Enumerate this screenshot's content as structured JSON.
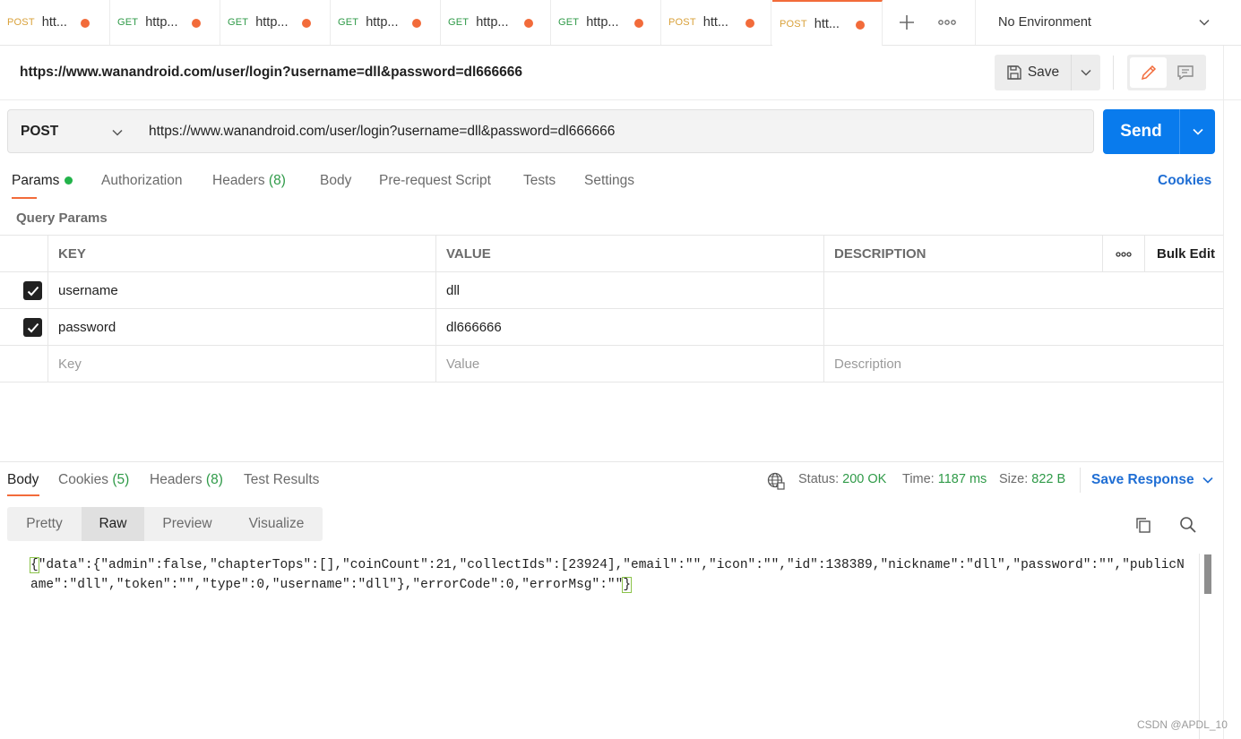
{
  "tabs": [
    {
      "method": "POST",
      "name": "htt..."
    },
    {
      "method": "GET",
      "name": "http..."
    },
    {
      "method": "GET",
      "name": "http..."
    },
    {
      "method": "GET",
      "name": "http..."
    },
    {
      "method": "GET",
      "name": "http..."
    },
    {
      "method": "GET",
      "name": "http..."
    },
    {
      "method": "POST",
      "name": "htt..."
    },
    {
      "method": "POST",
      "name": "htt..."
    }
  ],
  "environment": "No Environment",
  "request": {
    "title": "https://www.wanandroid.com/user/login?username=dll&password=dl666666",
    "save_label": "Save",
    "method": "POST",
    "url": "https://www.wanandroid.com/user/login?username=dll&password=dl666666",
    "send_label": "Send"
  },
  "request_tabs": {
    "params": "Params",
    "authorization": "Authorization",
    "headers": "Headers",
    "headers_count": "(8)",
    "body": "Body",
    "prerequest": "Pre-request Script",
    "tests": "Tests",
    "settings": "Settings",
    "cookies": "Cookies"
  },
  "query_params": {
    "title": "Query Params",
    "headers": {
      "key": "KEY",
      "value": "VALUE",
      "description": "DESCRIPTION",
      "bulk_edit": "Bulk Edit"
    },
    "rows": [
      {
        "key": "username",
        "value": "dll",
        "description": ""
      },
      {
        "key": "password",
        "value": "dl666666",
        "description": ""
      }
    ],
    "placeholders": {
      "key": "Key",
      "value": "Value",
      "description": "Description"
    }
  },
  "response": {
    "tabs": {
      "body": "Body",
      "cookies": "Cookies",
      "cookies_count": "(5)",
      "headers": "Headers",
      "headers_count": "(8)",
      "test_results": "Test Results"
    },
    "status_label": "Status:",
    "status_value": "200 OK",
    "time_label": "Time:",
    "time_value": "1187 ms",
    "size_label": "Size:",
    "size_value": "822 B",
    "save_response": "Save Response",
    "formats": [
      "Pretty",
      "Raw",
      "Preview",
      "Visualize"
    ],
    "body_start": "{",
    "body_middle": "\"data\":{\"admin\":false,\"chapterTops\":[],\"coinCount\":21,\"collectIds\":[23924],\"email\":\"\",\"icon\":\"\",\"id\":138389,\"nickname\":\"dll\",\"password\":\"\",\"publicName\":\"dll\",\"token\":\"\",\"type\":0,\"username\":\"dll\"},\"errorCode\":0,\"errorMsg\":\"\"",
    "body_end": "}"
  },
  "watermark": "CSDN @APDL_10"
}
